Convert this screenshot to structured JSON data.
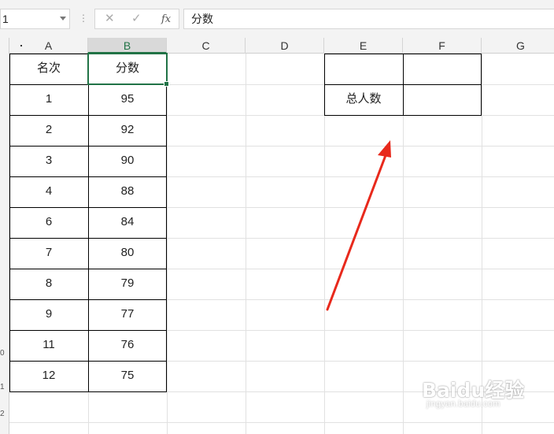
{
  "formula_bar": {
    "name_box": "1",
    "cancel_icon": "✕",
    "confirm_icon": "✓",
    "fx_label": "fx",
    "formula_value": "分数"
  },
  "columns": [
    "A",
    "B",
    "C",
    "D",
    "E",
    "F",
    "G"
  ],
  "selected_column": "B",
  "row_numbers": {
    "r1": "0",
    "r2": "1",
    "r3": "2"
  },
  "table": {
    "headers": {
      "rank": "名次",
      "score": "分数"
    },
    "rows": [
      {
        "rank": "1",
        "score": "95"
      },
      {
        "rank": "2",
        "score": "92"
      },
      {
        "rank": "3",
        "score": "90"
      },
      {
        "rank": "4",
        "score": "88"
      },
      {
        "rank": "6",
        "score": "84"
      },
      {
        "rank": "7",
        "score": "80"
      },
      {
        "rank": "8",
        "score": "79"
      },
      {
        "rank": "9",
        "score": "77"
      },
      {
        "rank": "11",
        "score": "76"
      },
      {
        "rank": "12",
        "score": "75"
      }
    ]
  },
  "side_box": {
    "label": "总人数",
    "value": ""
  },
  "annotation": {
    "arrow_color": "#e8291c"
  },
  "accent_color": "#217346",
  "watermark": {
    "brand": "Baidu经验",
    "url": "jingyan.baidu.com"
  }
}
